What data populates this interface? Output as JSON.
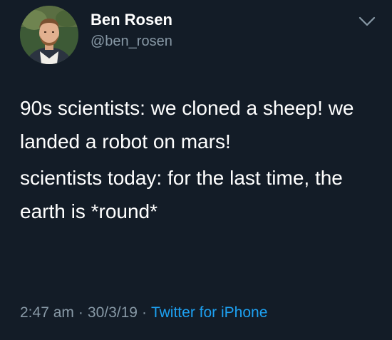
{
  "user": {
    "display_name": "Ben Rosen",
    "handle": "@ben_rosen",
    "avatar_icon": "profile-photo"
  },
  "tweet": {
    "paragraphs": [
      "90s scientists: we cloned a sheep! we landed a robot on mars!",
      "scientists today: for the last time, the earth is *round*"
    ],
    "time": "2:47 am",
    "separator": "·",
    "date": "30/3/19",
    "source": "Twitter for iPhone"
  },
  "icons": {
    "menu": "chevron-down-icon"
  },
  "colors": {
    "background": "#131c27",
    "text": "#ffffff",
    "secondary": "#8899a6",
    "link": "#1da1f2"
  }
}
